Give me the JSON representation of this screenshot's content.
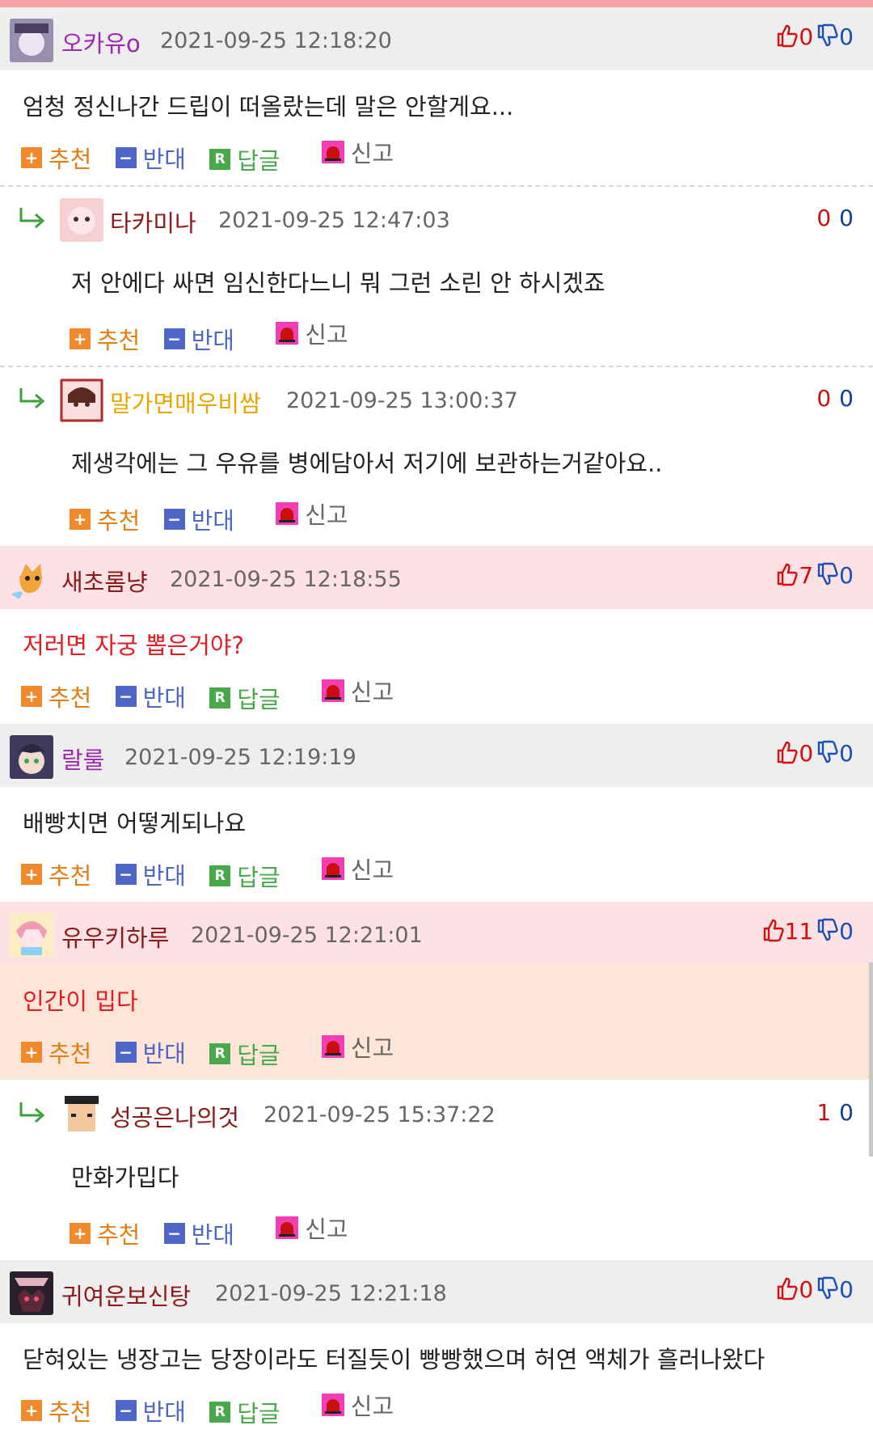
{
  "comments": [
    {
      "nick": "오카유o",
      "nick_color": "#9c27b0",
      "date": "2021-09-25 12:18:20",
      "up": "0",
      "down": "0",
      "text": "엄청 정신나간 드립이 떠올랐는데 말은 안할게요...",
      "kind": "top",
      "best": false,
      "red": false
    },
    {
      "nick": "타카미나",
      "nick_color": "#8b1a1a",
      "date": "2021-09-25 12:47:03",
      "up": "0",
      "down": "0",
      "text": "저 안에다 싸면 임신한다느니 뭐 그런 소린 안 하시겠죠",
      "kind": "reply",
      "best": false,
      "red": false
    },
    {
      "nick": "말가면매우비쌈",
      "nick_color": "#e6a800",
      "date": "2021-09-25 13:00:37",
      "up": "0",
      "down": "0",
      "text": "제생각에는 그 우유를 병에담아서 저기에 보관하는거같아요..",
      "kind": "reply",
      "best": false,
      "red": false
    },
    {
      "nick": "새초롬냥",
      "nick_color": "#8b1a1a",
      "date": "2021-09-25 12:18:55",
      "up": "7",
      "down": "0",
      "text": "저러면 자궁 뽑은거야?",
      "kind": "top",
      "best": true,
      "red": true
    },
    {
      "nick": "랄룰",
      "nick_color": "#9c27b0",
      "date": "2021-09-25 12:19:19",
      "up": "0",
      "down": "0",
      "text": "배빵치면 어떻게되나요",
      "kind": "top",
      "best": false,
      "red": false
    },
    {
      "nick": "유우키하루",
      "nick_color": "#8b1a1a",
      "date": "2021-09-25 12:21:01",
      "up": "11",
      "down": "0",
      "text": "인간이 밉다",
      "kind": "top",
      "best": true,
      "red": true
    },
    {
      "nick": "성공은나의것",
      "nick_color": "#8b1a1a",
      "date": "2021-09-25 15:37:22",
      "up": "1",
      "down": "0",
      "text": "만화가밉다",
      "kind": "reply",
      "best": false,
      "red": false
    },
    {
      "nick": "귀여운보신탕",
      "nick_color": "#8b1a1a",
      "date": "2021-09-25 12:21:18",
      "up": "0",
      "down": "0",
      "text": "닫혀있는 냉장고는 당장이라도 터질듯이 빵빵했으며 허연 액체가 흘러나왔다",
      "kind": "top",
      "best": false,
      "red": false
    }
  ],
  "labels": {
    "recommend": "추천",
    "oppose": "반대",
    "answer": "답글",
    "report": "신고",
    "answer_icon": "R"
  },
  "icons": {
    "up": "thumbs-up-icon",
    "down": "thumbs-down-icon",
    "reply": "reply-arrow-icon",
    "report": "siren-icon"
  }
}
